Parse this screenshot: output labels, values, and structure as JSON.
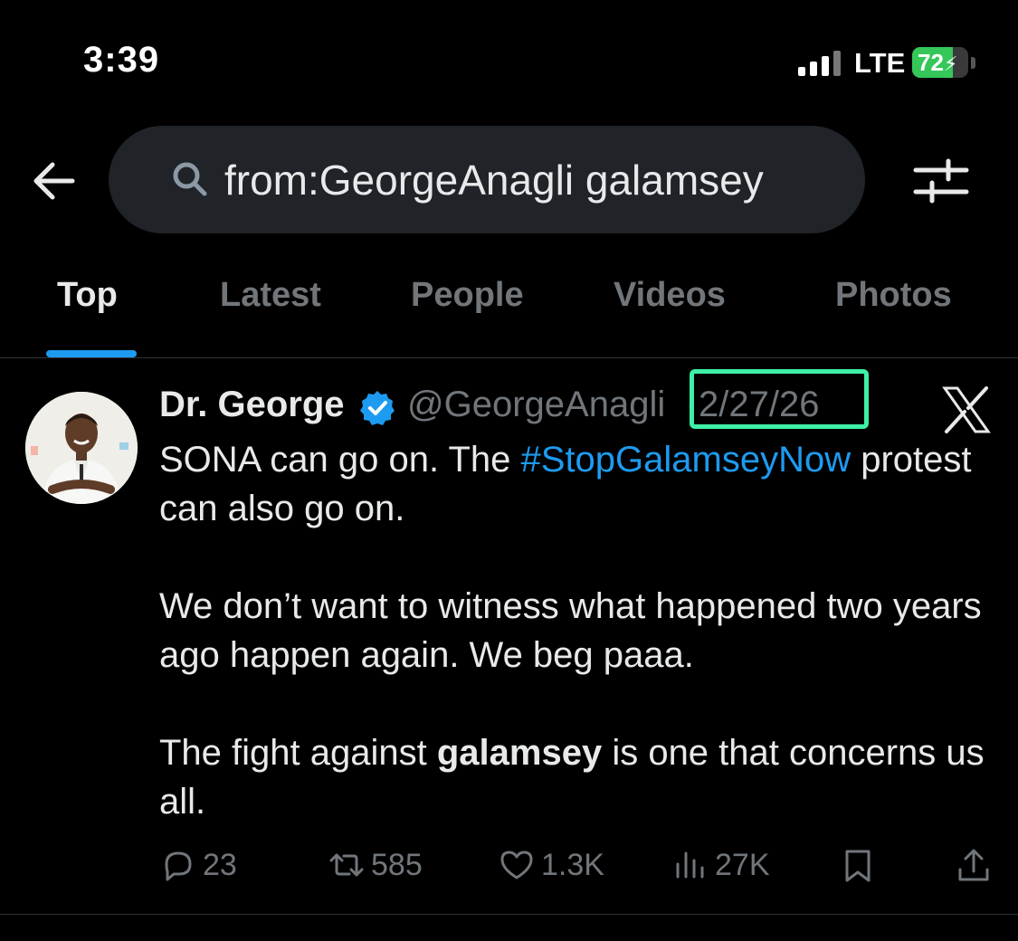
{
  "status_bar": {
    "time": "3:39",
    "network": "LTE",
    "battery": "72",
    "battery_level": 0.72,
    "icons": [
      "signal-icon",
      "battery-charging-icon"
    ]
  },
  "header": {
    "back_icon": "arrow-left-icon",
    "search": {
      "query": "from:GeorgeAnagli galamsey",
      "icon": "search-icon"
    },
    "filter_icon": "sliders-icon"
  },
  "tabs": [
    {
      "label": "Top",
      "active": true
    },
    {
      "label": "Latest",
      "active": false
    },
    {
      "label": "People",
      "active": false
    },
    {
      "label": "Videos",
      "active": false
    },
    {
      "label": "Photos",
      "active": false
    }
  ],
  "tweet": {
    "author_name": "Dr. George",
    "handle": "@GeorgeAnagli",
    "separator": "·",
    "date": "2/27/26",
    "watermark_icon": "x-logo-icon",
    "text": {
      "p1_start": "SONA can go on. The ",
      "p1_hashtag": "#StopGalamseyNow",
      "p1_end": " protest can also go on.",
      "p2": "We don’t want to witness what happened two years ago happen again. We beg paaa.",
      "p3_start": "The fight against ",
      "p3_bold": "galamsey",
      "p3_end": " is one that concerns us all."
    },
    "stats": {
      "replies": "23",
      "reposts": "585",
      "likes": "1.3K",
      "views": "27K"
    }
  },
  "colors": {
    "background": "#000000",
    "text": "#e7e9ea",
    "muted": "#71767b",
    "accent": "#1d9bf0",
    "highlight": "#3ef0a7"
  }
}
